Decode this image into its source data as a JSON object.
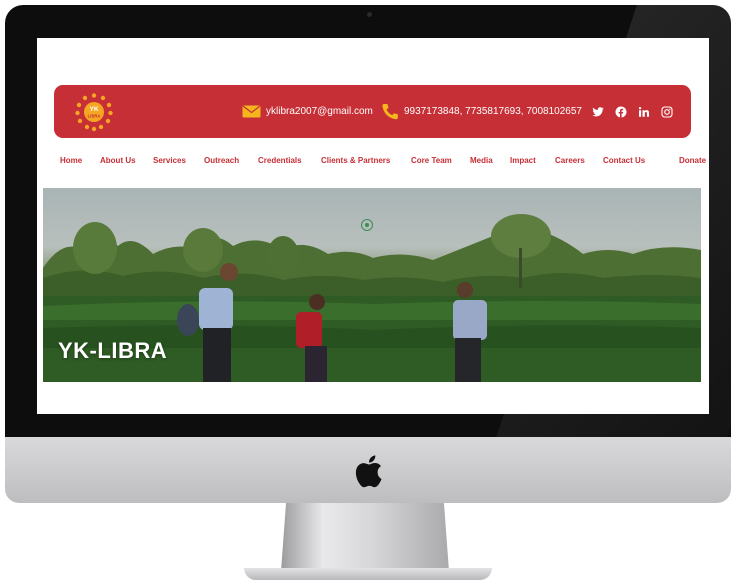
{
  "site": {
    "logo_text_top": "YK",
    "logo_text_bottom": "LIBRA",
    "brand_color": "#c62f36",
    "contact": {
      "email_icon": "envelope-icon",
      "email": "yklibra2007@gmail.com",
      "phone_icon": "phone-icon",
      "phones": "9937173848, 7735817693, 7008102657"
    },
    "socials": [
      "twitter-icon",
      "facebook-icon",
      "linkedin-icon",
      "instagram-icon"
    ],
    "nav": [
      "Home",
      "About Us",
      "Services",
      "Outreach",
      "Credentials",
      "Clients & Partners",
      "Core Team",
      "Media",
      "Impact",
      "Careers",
      "Contact Us",
      "Donate"
    ],
    "hero": {
      "title": "YK-LIBRA"
    }
  }
}
